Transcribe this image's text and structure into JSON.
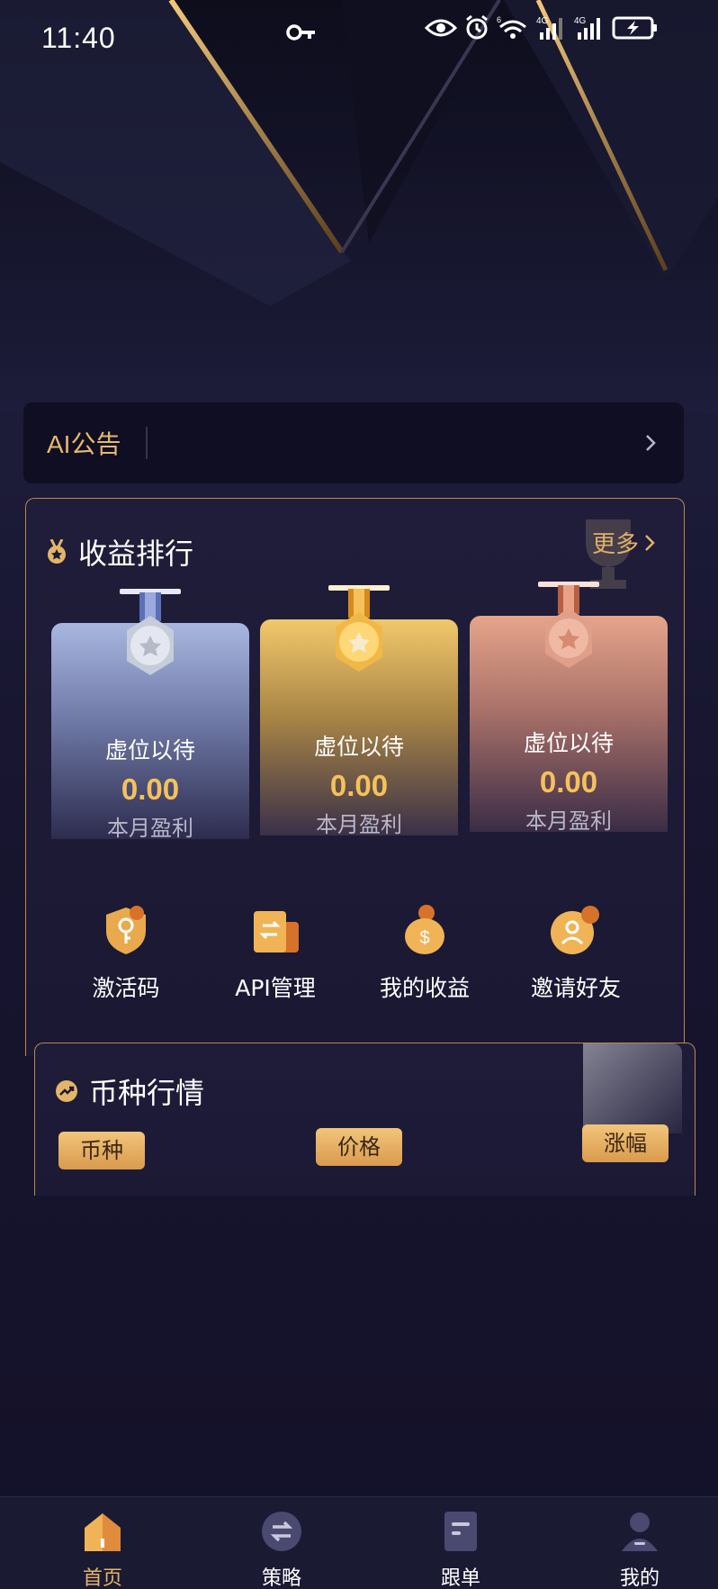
{
  "status_bar": {
    "time": "11:40",
    "icons": [
      "key-icon",
      "eye-icon",
      "alarm-icon",
      "wifi-icon",
      "signal-4g-icon",
      "signal-4g-icon",
      "battery-charging-icon"
    ],
    "wifi_badge": "6",
    "network_labels": [
      "4G",
      "4G"
    ]
  },
  "announcement": {
    "title": "AI公告",
    "text": ""
  },
  "ranking": {
    "title": "收益排行",
    "more_label": "更多",
    "cards": [
      {
        "tier": "silver",
        "name": "虚位以待",
        "value": "0.00",
        "caption": "本月盈利"
      },
      {
        "tier": "gold",
        "name": "虚位以待",
        "value": "0.00",
        "caption": "本月盈利"
      },
      {
        "tier": "bronze",
        "name": "虚位以待",
        "value": "0.00",
        "caption": "本月盈利"
      }
    ]
  },
  "quick_actions": [
    {
      "label": "激活码",
      "icon": "shield-key-icon"
    },
    {
      "label": "API管理",
      "icon": "api-card-icon"
    },
    {
      "label": "我的收益",
      "icon": "money-bag-icon"
    },
    {
      "label": "邀请好友",
      "icon": "invite-user-icon"
    }
  ],
  "market": {
    "title": "币种行情",
    "columns": [
      "币种",
      "价格",
      "涨幅"
    ]
  },
  "tabs": [
    {
      "label": "首页",
      "icon": "home-icon",
      "active": true
    },
    {
      "label": "策略",
      "icon": "swap-icon",
      "active": false
    },
    {
      "label": "跟单",
      "icon": "document-icon",
      "active": false
    },
    {
      "label": "我的",
      "icon": "user-icon",
      "active": false
    }
  ],
  "colors": {
    "accent_gold": "#e4b568",
    "background": "#14122a",
    "panel_border": "#b9894a"
  }
}
